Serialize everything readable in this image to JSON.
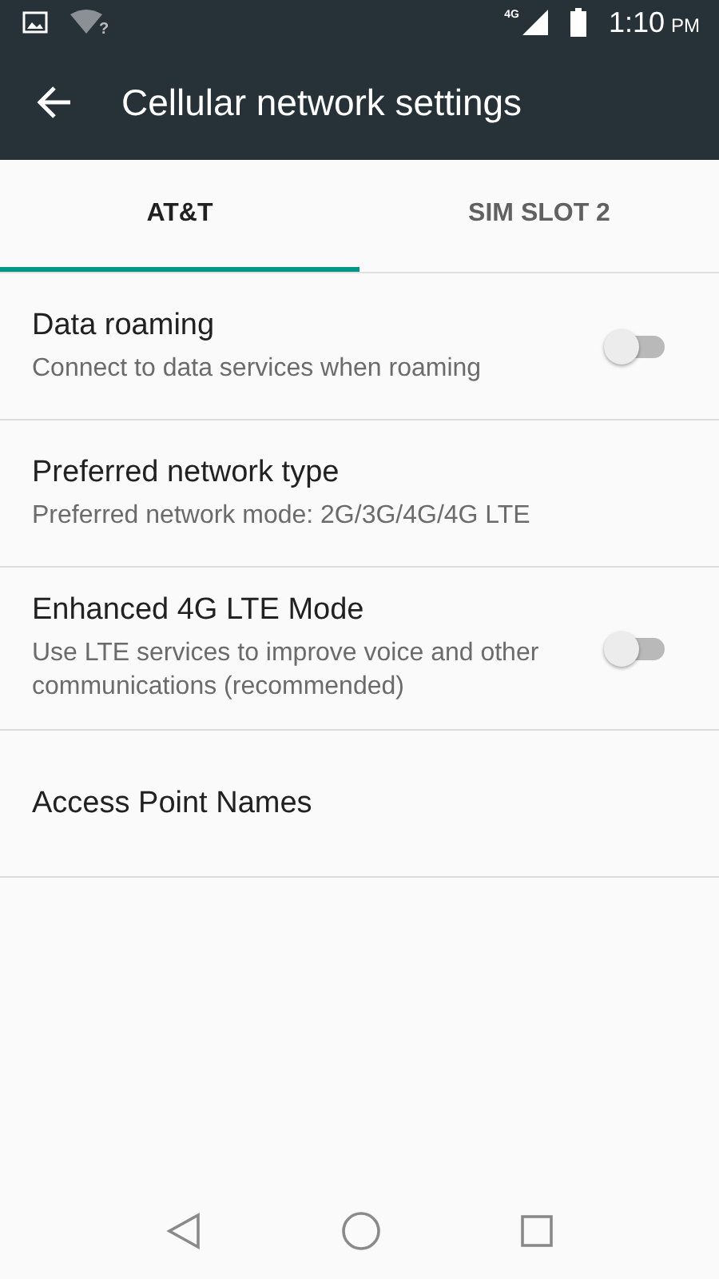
{
  "status_bar": {
    "network_type": "4G",
    "wifi_unknown": "?",
    "time": "1:10",
    "am_pm": "PM"
  },
  "app_bar": {
    "title": "Cellular network settings"
  },
  "tabs": [
    {
      "label": "AT&T",
      "selected": true
    },
    {
      "label": "SIM SLOT 2",
      "selected": false
    }
  ],
  "settings": [
    {
      "kind": "toggle",
      "title": "Data roaming",
      "summary": "Connect to data services when roaming",
      "on": false
    },
    {
      "kind": "text",
      "title": "Preferred network type",
      "summary": "Preferred network mode: 2G/3G/4G/4G LTE"
    },
    {
      "kind": "toggle",
      "title": "Enhanced 4G LTE Mode",
      "summary": "Use LTE services to improve voice and other communications (recommended)",
      "on": false
    },
    {
      "kind": "text",
      "title": "Access Point Names"
    }
  ]
}
